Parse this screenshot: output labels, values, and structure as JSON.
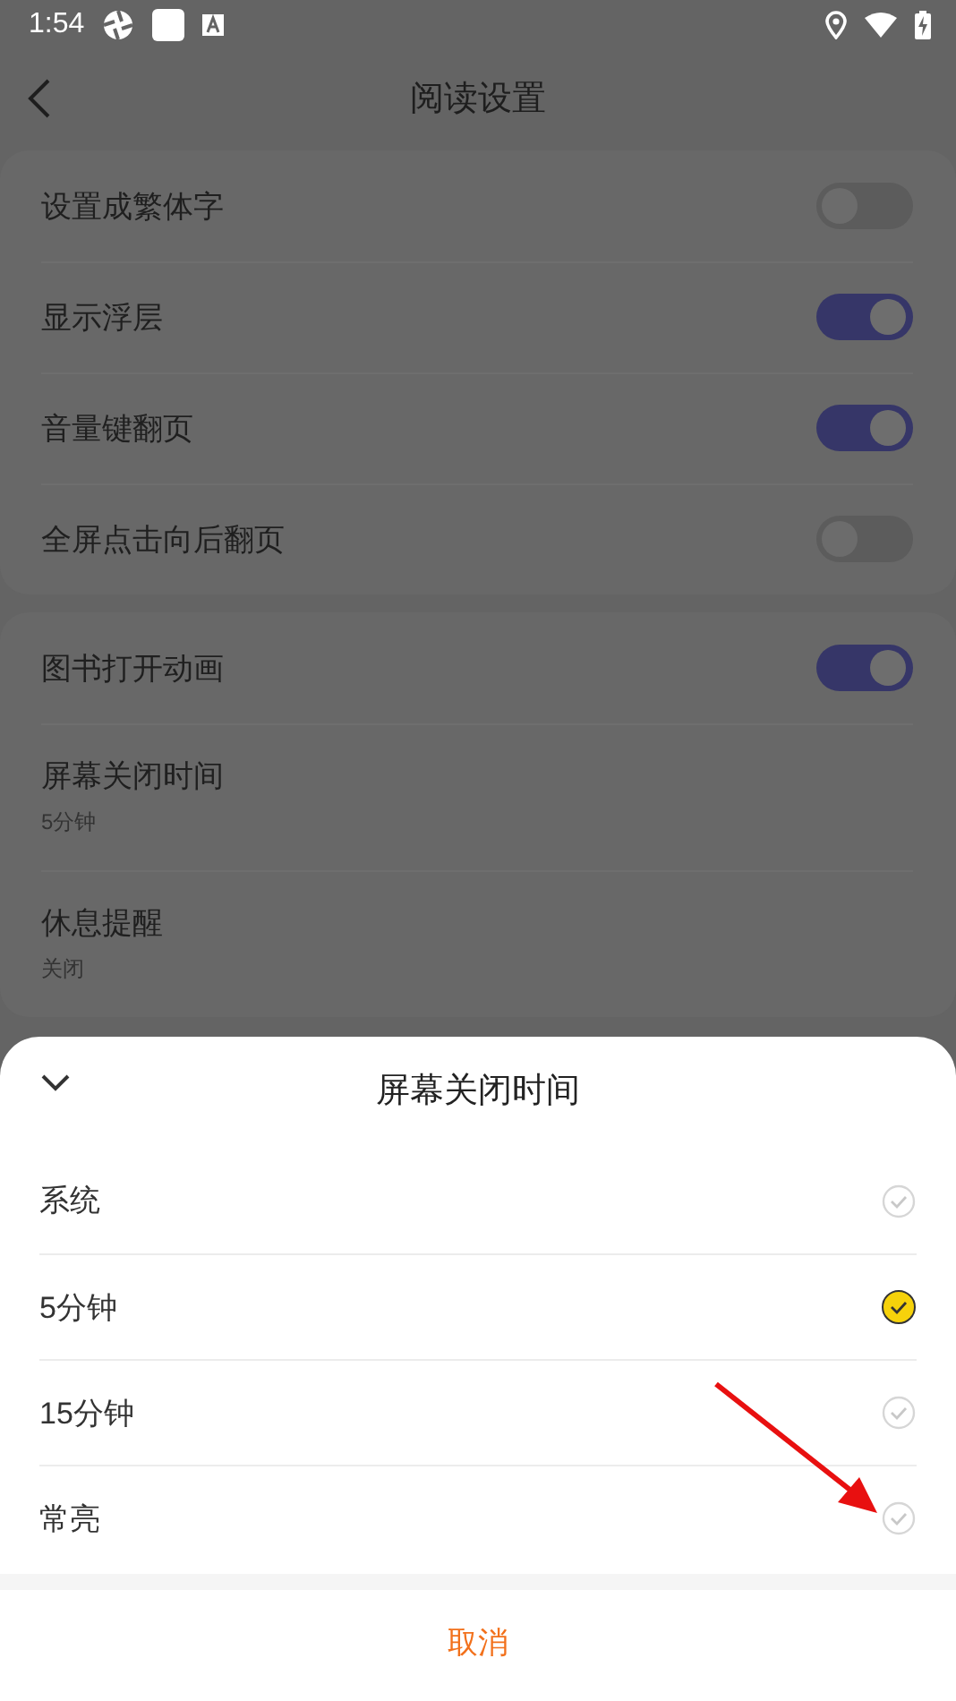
{
  "status_bar": {
    "time": "1:54"
  },
  "header": {
    "title": "阅读设置"
  },
  "sections": [
    [
      {
        "kind": "toggle",
        "label": "设置成繁体字",
        "on": false
      },
      {
        "kind": "toggle",
        "label": "显示浮层",
        "on": true
      },
      {
        "kind": "toggle",
        "label": "音量键翻页",
        "on": true
      },
      {
        "kind": "toggle",
        "label": "全屏点击向后翻页",
        "on": false
      }
    ],
    [
      {
        "kind": "toggle",
        "label": "图书打开动画",
        "on": true
      },
      {
        "kind": "value",
        "label": "屏幕关闭时间",
        "value": "5分钟"
      },
      {
        "kind": "value",
        "label": "休息提醒",
        "value": "关闭"
      }
    ]
  ],
  "sheet": {
    "title": "屏幕关闭时间",
    "options": [
      {
        "label": "系统",
        "selected": false
      },
      {
        "label": "5分钟",
        "selected": true
      },
      {
        "label": "15分钟",
        "selected": false
      },
      {
        "label": "常亮",
        "selected": false
      }
    ],
    "cancel": "取消"
  }
}
